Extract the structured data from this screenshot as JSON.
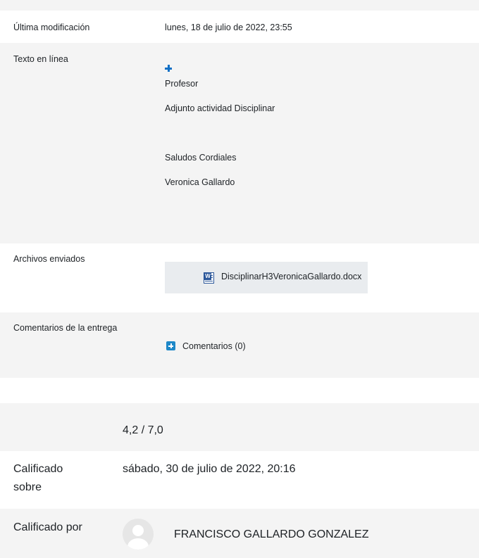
{
  "submission": {
    "last_modified_label": "Última modificación",
    "last_modified_value": "lunes, 18 de julio de 2022, 23:55",
    "online_text_label": "Texto en línea",
    "online_text_lines": [
      "Profesor",
      "Adjunto actividad Disciplinar",
      "Saludos Cordiales",
      "Veronica Gallardo"
    ],
    "files_label": "Archivos enviados",
    "file_name": "DisciplinarH3VeronicaGallardo.docx",
    "comments_label": "Comentarios de la entrega",
    "comments_link": "Comentarios (0)"
  },
  "grade": {
    "value": "4,2 / 7,0",
    "graded_on_label_line1": "Calificado",
    "graded_on_label_line2": "sobre",
    "graded_on_value": "sábado, 30 de julio de 2022, 20:16",
    "graded_by_label": "Calificado por",
    "grader_name": "FRANCISCO GALLARDO GONZALEZ"
  },
  "icons": {
    "expand": "plus-icon",
    "file": "word-document-icon",
    "comments": "plus-square-icon",
    "avatar": "user-avatar-icon"
  },
  "colors": {
    "accent_blue": "#0f6fc5",
    "row_alt": "#f4f4f4",
    "file_bg": "#e9ecef"
  }
}
